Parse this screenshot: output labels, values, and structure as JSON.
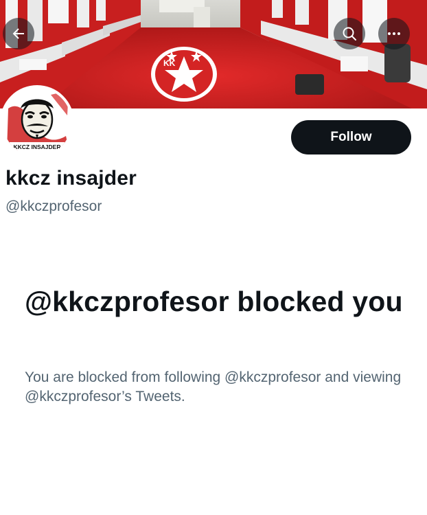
{
  "profile": {
    "display_name": "kkcz insajder",
    "handle": "@kkczprofesor",
    "avatar_text": "KKCZ INSAJDER",
    "banner_logo_text": "KK"
  },
  "actions": {
    "follow_label": "Follow"
  },
  "blocked": {
    "title": "@kkczprofesor blocked you",
    "description": "You are blocked from following @kkczprofesor and viewing @kkczprofesor’s Tweets."
  },
  "icons": {
    "back": "arrow-left-icon",
    "search": "search-icon",
    "more": "more-horizontal-icon"
  },
  "colors": {
    "text_primary": "#0f1419",
    "text_secondary": "#536471",
    "button_dark": "#0f1419",
    "banner_red": "#c41e1e"
  }
}
